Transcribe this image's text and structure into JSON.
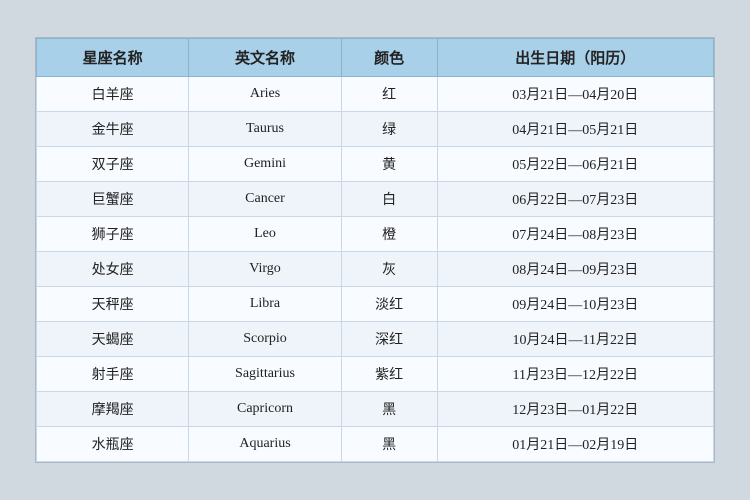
{
  "table": {
    "headers": [
      "星座名称",
      "英文名称",
      "颜色",
      "出生日期（阳历）"
    ],
    "rows": [
      {
        "zh": "白羊座",
        "en": "Aries",
        "color": "红",
        "dates": "03月21日—04月20日"
      },
      {
        "zh": "金牛座",
        "en": "Taurus",
        "color": "绿",
        "dates": "04月21日—05月21日"
      },
      {
        "zh": "双子座",
        "en": "Gemini",
        "color": "黄",
        "dates": "05月22日—06月21日"
      },
      {
        "zh": "巨蟹座",
        "en": "Cancer",
        "color": "白",
        "dates": "06月22日—07月23日"
      },
      {
        "zh": "狮子座",
        "en": "Leo",
        "color": "橙",
        "dates": "07月24日—08月23日"
      },
      {
        "zh": "处女座",
        "en": "Virgo",
        "color": "灰",
        "dates": "08月24日—09月23日"
      },
      {
        "zh": "天秤座",
        "en": "Libra",
        "color": "淡红",
        "dates": "09月24日—10月23日"
      },
      {
        "zh": "天蝎座",
        "en": "Scorpio",
        "color": "深红",
        "dates": "10月24日—11月22日"
      },
      {
        "zh": "射手座",
        "en": "Sagittarius",
        "color": "紫红",
        "dates": "11月23日—12月22日"
      },
      {
        "zh": "摩羯座",
        "en": "Capricorn",
        "color": "黑",
        "dates": "12月23日—01月22日"
      },
      {
        "zh": "水瓶座",
        "en": "Aquarius",
        "color": "黑",
        "dates": "01月21日—02月19日"
      }
    ]
  }
}
